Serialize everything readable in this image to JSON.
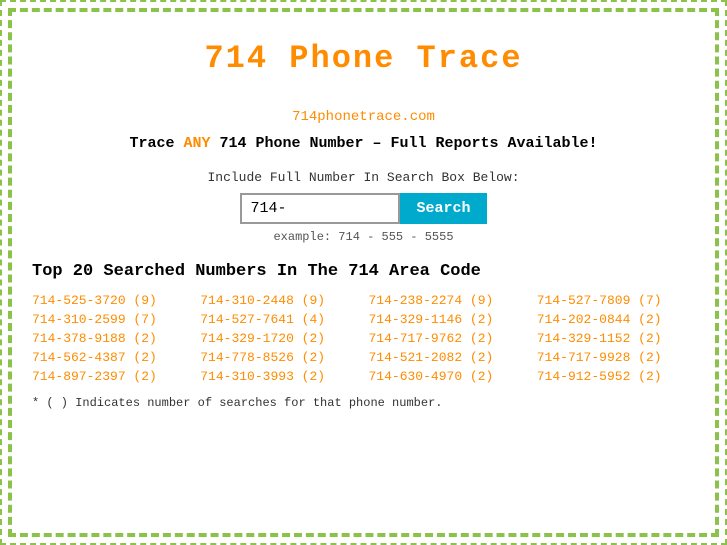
{
  "page": {
    "title": "714 Phone Trace",
    "border_color": "#8BC34A"
  },
  "site": {
    "url_label": "714phonetrace.com"
  },
  "tagline": {
    "prefix": "Trace ",
    "highlight": "ANY",
    "suffix": " 714 Phone Number – Full Reports Available!"
  },
  "search": {
    "label": "Include Full Number In Search Box Below:",
    "input_value": "714-",
    "button_label": "Search",
    "example": "example: 714 - 555 - 5555"
  },
  "top_section": {
    "title": "Top 20 Searched Numbers In The 714 Area Code"
  },
  "numbers": [
    {
      "number": "714-525-3720",
      "count": "(9)"
    },
    {
      "number": "714-310-2448",
      "count": "(9)"
    },
    {
      "number": "714-238-2274",
      "count": "(9)"
    },
    {
      "number": "714-527-7809",
      "count": "(7)"
    },
    {
      "number": "714-310-2599",
      "count": "(7)"
    },
    {
      "number": "714-527-7641",
      "count": "(4)"
    },
    {
      "number": "714-329-1146",
      "count": "(2)"
    },
    {
      "number": "714-202-0844",
      "count": "(2)"
    },
    {
      "number": "714-378-9188",
      "count": "(2)"
    },
    {
      "number": "714-329-1720",
      "count": "(2)"
    },
    {
      "number": "714-717-9762",
      "count": "(2)"
    },
    {
      "number": "714-329-1152",
      "count": "(2)"
    },
    {
      "number": "714-562-4387",
      "count": "(2)"
    },
    {
      "number": "714-778-8526",
      "count": "(2)"
    },
    {
      "number": "714-521-2082",
      "count": "(2)"
    },
    {
      "number": "714-717-9928",
      "count": "(2)"
    },
    {
      "number": "714-897-2397",
      "count": "(2)"
    },
    {
      "number": "714-310-3993",
      "count": "(2)"
    },
    {
      "number": "714-630-4970",
      "count": "(2)"
    },
    {
      "number": "714-912-5952",
      "count": "(2)"
    }
  ],
  "footnote": "* ( ) Indicates number of searches for that phone number."
}
